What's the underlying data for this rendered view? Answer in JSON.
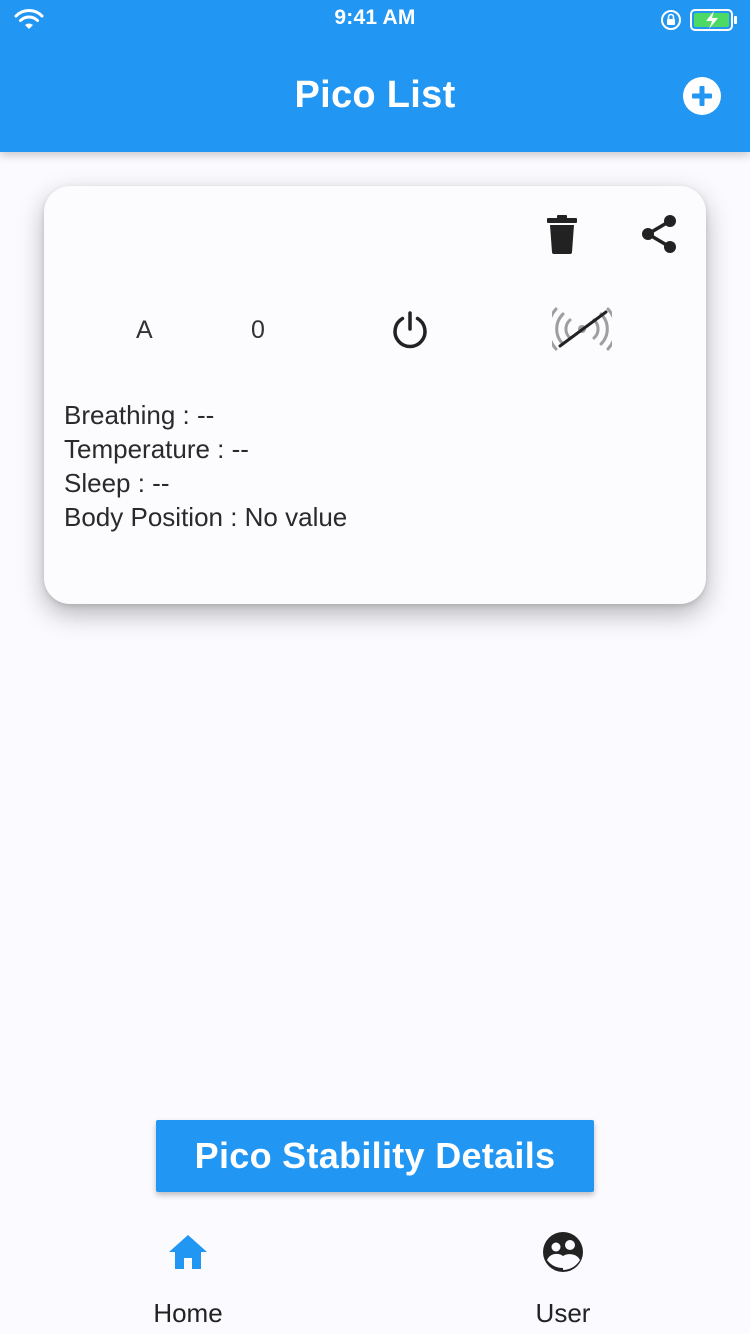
{
  "status_bar": {
    "time": "9:41 AM",
    "left_icon": "wifi-icon",
    "right_icons": [
      "rotation-lock-icon",
      "battery-charging-icon"
    ]
  },
  "header": {
    "title": "Pico List",
    "action_icon": "add-circle-icon"
  },
  "card": {
    "actions": [
      "trash-icon",
      "share-icon"
    ],
    "device_name": "A",
    "count": "0",
    "power_icon": "power-icon",
    "signal_icon": "signal-off-icon",
    "readings": [
      "Breathing : --",
      "Temperature : --",
      "Sleep : --",
      "Body Position : No value"
    ]
  },
  "stability_button": {
    "label": "Pico Stability Details"
  },
  "bottom_nav": {
    "items": [
      {
        "label": "Home",
        "icon": "home-icon",
        "active": true
      },
      {
        "label": "User",
        "icon": "user-group-icon",
        "active": false
      }
    ]
  },
  "colors": {
    "primary": "#2196f3",
    "background": "#fbfbff",
    "text": "#222222"
  }
}
